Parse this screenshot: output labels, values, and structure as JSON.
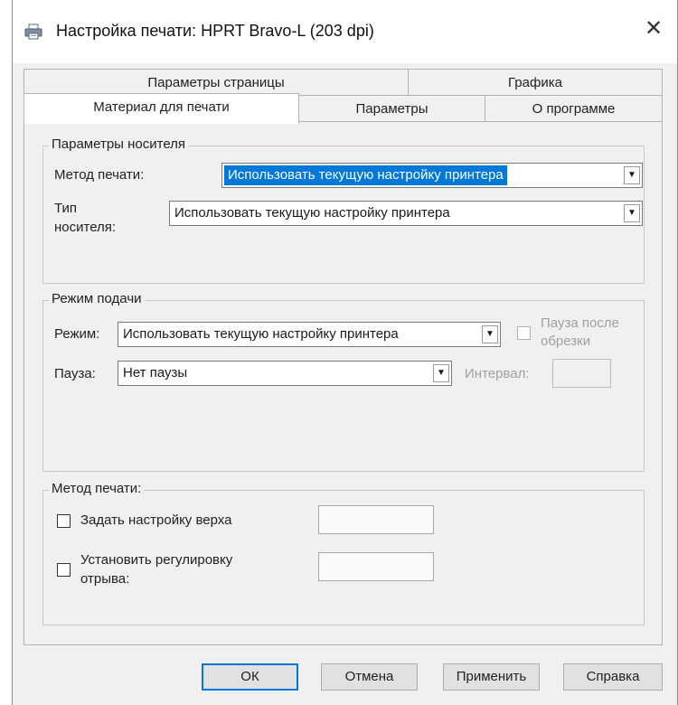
{
  "window": {
    "title": "Настройка печати: HPRT Bravo-L (203 dpi)",
    "title_icon": "printer-icon",
    "close_glyph": "✕"
  },
  "tabs": {
    "top_row": [
      "Параметры страницы",
      "Графика"
    ],
    "bottom_row": [
      "Материал для печати",
      "Параметры",
      "О программе"
    ],
    "active": "Материал для печати"
  },
  "media_params": {
    "legend": "Параметры носителя",
    "print_method_label": "Метод печати:",
    "print_method_value": "Использовать текущую настройку принтера",
    "media_type_label_1": "Тип",
    "media_type_label_2": "носителя:",
    "media_type_value": "Использовать текущую настройку принтера"
  },
  "feed_mode": {
    "legend": "Режим подачи",
    "mode_label": "Режим:",
    "mode_value": "Использовать текущую настройку принтера",
    "pause_after_cut_line1": "Пауза после",
    "pause_after_cut_line2": "обрезки",
    "pause_label": "Пауза:",
    "pause_value": "Нет паузы",
    "interval_label": "Интервал:"
  },
  "print_method": {
    "legend": "Метод печати:",
    "set_top_label": "Задать настройку верха",
    "tear_adjust_line1": "Установить регулировку",
    "tear_adjust_line2": "отрыва:"
  },
  "buttons": {
    "ok": "ОК",
    "cancel": "Отмена",
    "apply": "Применить",
    "help": "Справка"
  },
  "colors": {
    "selection": "#0078d7",
    "default_button_border": "#0078d7",
    "dialog_background": "#f0f0f0"
  }
}
